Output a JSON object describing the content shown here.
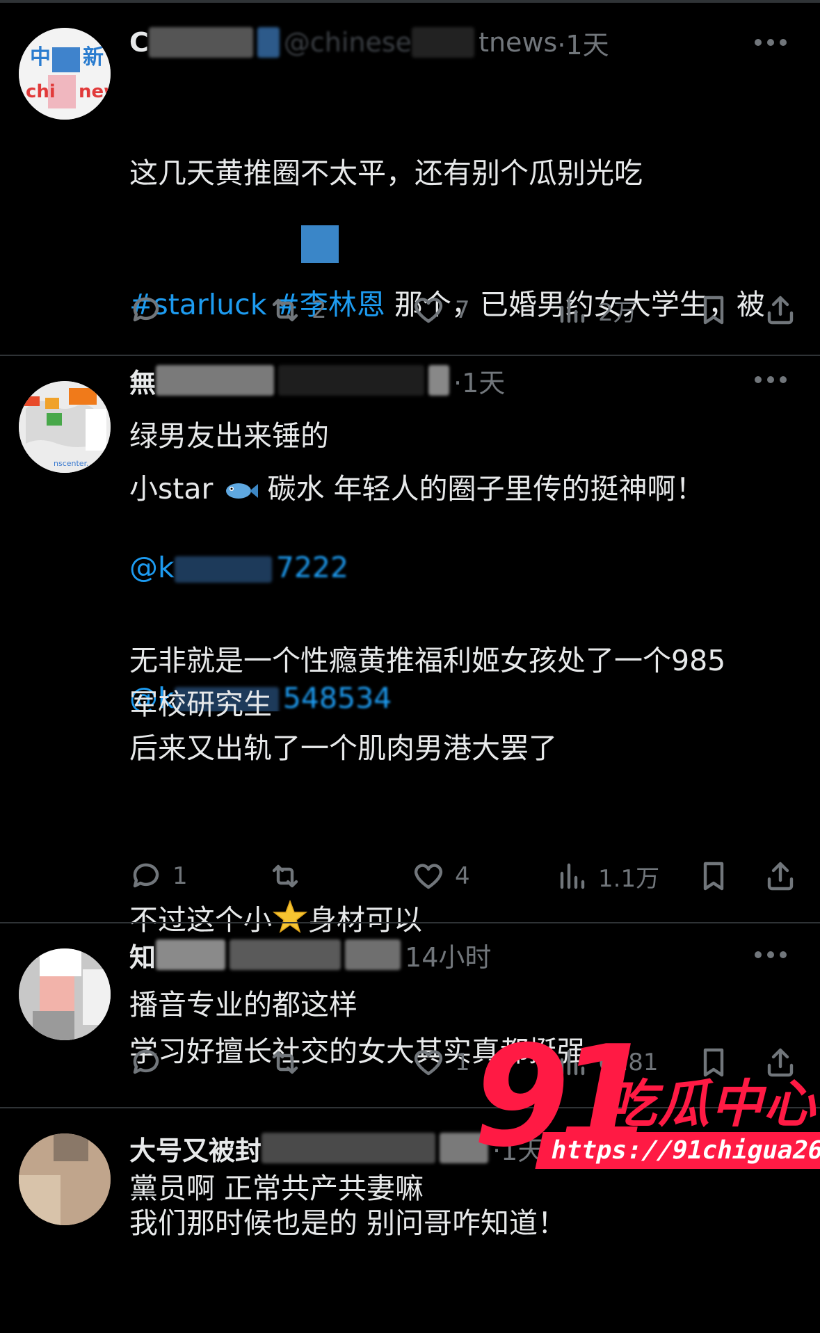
{
  "posts": [
    {
      "handle_visible": "C",
      "handle_fragment": "@chinese",
      "handle_tail": "tnews",
      "time": "·1天",
      "text_line1": "这几天黄推圈不太平，还有别个瓜别光吃",
      "hashtag1": "#starluck",
      "hashtag2": "#李林恩",
      "text_line2_rest": " 那个，已婚男约女大学生，被",
      "text_line3": "绿男友出来锤的",
      "mention1": "@k",
      "mention1_tail": "7222",
      "mention2": "@k",
      "mention2_tail": "548534",
      "replies": "",
      "retweets": "2",
      "likes": "7",
      "views": "2万"
    },
    {
      "handle_visible": "無",
      "time": "·1天",
      "line1_a": "小star",
      "line1_b": "碳水 年轻人的圈子里传的挺神啊！",
      "para2": "无非就是一个性瘾黄推福利姬女孩处了一个985\n军校研究生\n后来又出轨了一个肌肉男港大罢了",
      "line3_a": "不过这个小",
      "line3_b": "身材可以",
      "line4": "学习好擅长社交的女大其实真都挺强",
      "para4": "我们那时候也是的 别问哥咋知道！",
      "replies": "1",
      "retweets": "",
      "likes": "4",
      "views": "1.1万"
    },
    {
      "handle_visible": "知",
      "time": "14小时",
      "text": "播音专业的都这样",
      "replies": "",
      "retweets": "",
      "likes": "1",
      "views": "6181"
    },
    {
      "handle_visible": "大号又被封",
      "time": "·1天",
      "text": "黨员啊 正常共产共妻嘛"
    }
  ],
  "watermark": {
    "number": "91",
    "name": "吃瓜中心",
    "url": "https://91chigua26.com"
  },
  "colors": {
    "background": "#000000",
    "text": "#e7e9ea",
    "muted": "#71767b",
    "link": "#1d9bf0",
    "separator": "#2f3336",
    "watermark": "#ff1a44"
  }
}
